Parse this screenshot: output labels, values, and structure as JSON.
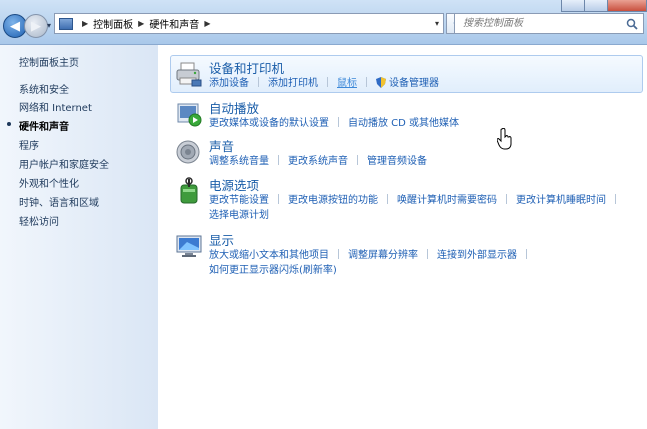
{
  "address_bar": {
    "breadcrumbs": [
      "控制面板",
      "硬件和声音"
    ]
  },
  "search": {
    "placeholder": "搜索控制面板"
  },
  "sidebar": {
    "items": [
      {
        "label": "控制面板主页",
        "current": false
      },
      {
        "label": "系统和安全",
        "current": false
      },
      {
        "label": "网络和 Internet",
        "current": false
      },
      {
        "label": "硬件和声音",
        "current": true
      },
      {
        "label": "程序",
        "current": false
      },
      {
        "label": "用户帐户和家庭安全",
        "current": false
      },
      {
        "label": "外观和个性化",
        "current": false
      },
      {
        "label": "时钟、语言和区域",
        "current": false
      },
      {
        "label": "轻松访问",
        "current": false
      }
    ]
  },
  "categories": {
    "devices": {
      "title": "设备和打印机",
      "links": [
        "添加设备",
        "添加打印机",
        "鼠标",
        "设备管理器"
      ]
    },
    "autoplay": {
      "title": "自动播放",
      "links": [
        "更改媒体或设备的默认设置",
        "自动播放 CD 或其他媒体"
      ]
    },
    "sound": {
      "title": "声音",
      "links": [
        "调整系统音量",
        "更改系统声音",
        "管理音频设备"
      ]
    },
    "power": {
      "title": "电源选项",
      "links": [
        "更改节能设置",
        "更改电源按钮的功能",
        "唤醒计算机时需要密码",
        "更改计算机睡眠时间",
        "选择电源计划"
      ]
    },
    "display": {
      "title": "显示",
      "links": [
        "放大或缩小文本和其他项目",
        "调整屏幕分辨率",
        "连接到外部显示器",
        "如何更正显示器闪烁(刷新率)"
      ]
    }
  },
  "colors": {
    "title_link": "#1a5da8",
    "task_link": "#1e5fb4",
    "nav_text": "#1e395b"
  }
}
